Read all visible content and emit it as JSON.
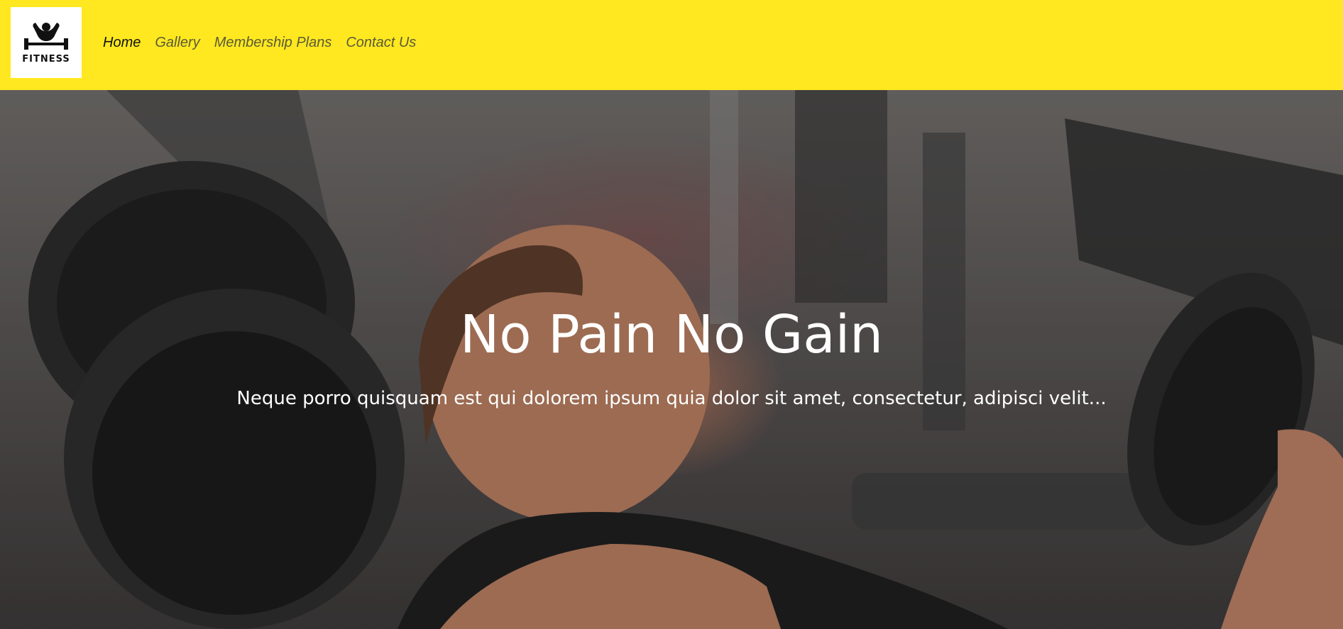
{
  "brand": {
    "logo_text": "FITNESS",
    "logo_icon": "bodybuilder-icon",
    "accent_color": "#ffe81f"
  },
  "nav": {
    "items": [
      {
        "label": "Home",
        "active": true
      },
      {
        "label": "Gallery",
        "active": false
      },
      {
        "label": "Membership Plans",
        "active": false
      },
      {
        "label": "Contact Us",
        "active": false
      }
    ]
  },
  "hero": {
    "title": "No Pain No Gain",
    "subtitle": "Neque porro quisquam est qui dolorem ipsum quia dolor sit amet, consectetur, adipisci velit..."
  }
}
